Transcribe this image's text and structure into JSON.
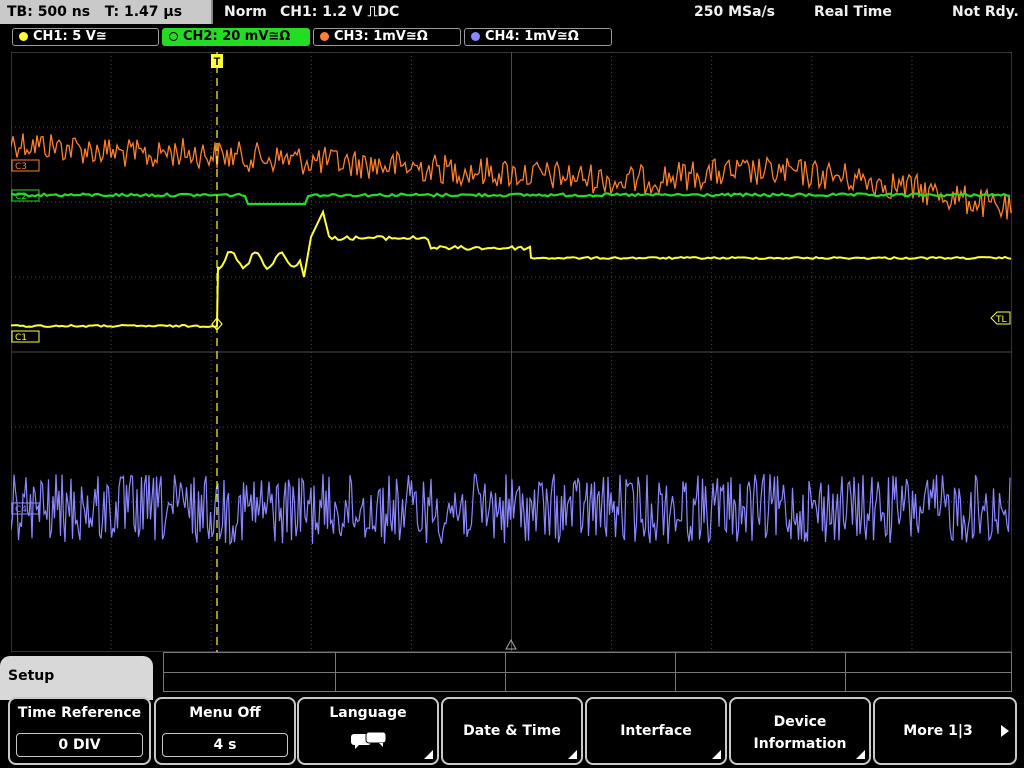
{
  "status": {
    "timebase": "TB: 500 ns",
    "trigger_time": "T: 1.47 µs",
    "mode": "Norm",
    "trigger": "CH1: 1.2 V ⎍DC",
    "sample_rate": "250 MSa/s",
    "acq_mode": "Real Time",
    "ready": "Not Rdy."
  },
  "channels": [
    {
      "label": "CH1: 5 V≅",
      "color": "#ffff33"
    },
    {
      "label": "CH2: 20 mV≅Ω",
      "color": "#22dd22"
    },
    {
      "label": "CH3: 1mV≅Ω",
      "color": "#ff7f2a"
    },
    {
      "label": "CH4: 1mV≅Ω",
      "color": "#8a86ff"
    }
  ],
  "markers": {
    "c1": "C1",
    "c2": "C2",
    "c3": "C3",
    "c4": "C4",
    "trigger_level": "TL",
    "trigger_pos": "T"
  },
  "menu": {
    "title": "Setup",
    "time_reference": {
      "label": "Time Reference",
      "value": "0 DIV"
    },
    "menu_off": {
      "label": "Menu Off",
      "value": "4 s"
    },
    "language": {
      "label": "Language",
      "icon": "speech-bubbles-icon"
    },
    "date_time": {
      "label": "Date & Time"
    },
    "interface": {
      "label": "Interface"
    },
    "device_info": {
      "line1": "Device",
      "line2": "Information"
    },
    "more": {
      "label": "More 1|3",
      "icon": "arrow-right-icon"
    }
  }
}
